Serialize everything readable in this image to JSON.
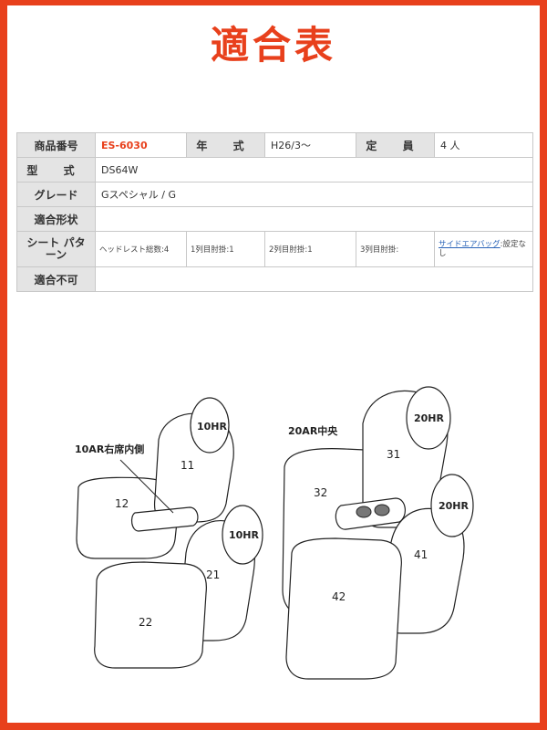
{
  "title": "適合表",
  "spec": {
    "product_no_label": "商品番号",
    "product_no": "ES-6030",
    "year_label": "年 式",
    "year": "H26/3～",
    "capacity_label": "定 員",
    "capacity": "4 人",
    "model_label": "型 式",
    "model": "DS64W",
    "grade_label": "グレード",
    "grade": "Gスペシャル / G",
    "fit_shape_label": "適合形状",
    "fit_shape": "",
    "seat_pattern_label": "シート\nパターン",
    "headrest": "ヘッドレスト総数:4",
    "row1_armrest": "1列目肘掛:1",
    "row2_armrest": "2列目肘掛:1",
    "row3_armrest": "3列目肘掛:",
    "side_airbag_link": "サイドエアバッグ",
    "side_airbag_rest": ":設定なし",
    "incompatible_label": "適合不可",
    "incompatible": ""
  },
  "diagram": {
    "labels": {
      "hr10_a": "10HR",
      "hr10_b": "10HR",
      "hr20_a": "20HR",
      "hr20_b": "20HR",
      "ar10": "10AR右席内側",
      "ar20": "20AR中央",
      "p11": "11",
      "p12": "12",
      "p21": "21",
      "p22": "22",
      "p31": "31",
      "p32": "32",
      "p41": "41",
      "p42": "42"
    }
  }
}
